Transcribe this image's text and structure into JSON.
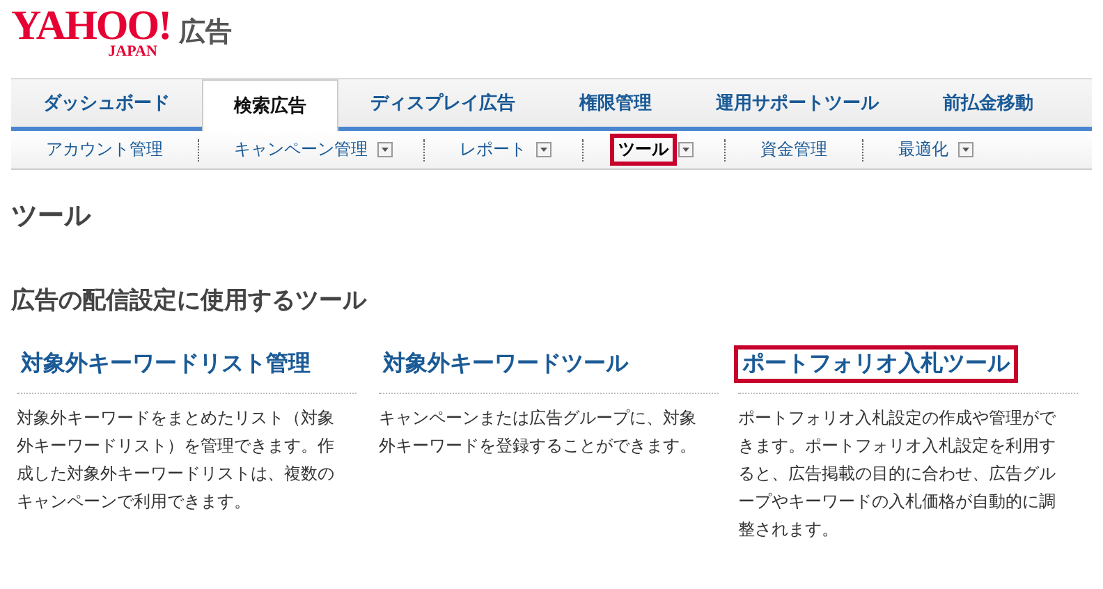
{
  "header": {
    "logo": {
      "name": "YAHOO!",
      "sub": "JAPAN"
    },
    "service": "広告"
  },
  "tabs": [
    {
      "label": "ダッシュボード",
      "selected": false
    },
    {
      "label": "検索広告",
      "selected": true
    },
    {
      "label": "ディスプレイ広告",
      "selected": false
    },
    {
      "label": "権限管理",
      "selected": false
    },
    {
      "label": "運用サポートツール",
      "selected": false
    },
    {
      "label": "前払金移動",
      "selected": false
    }
  ],
  "subnav": [
    {
      "label": "アカウント管理",
      "dropdown": false,
      "selected": false
    },
    {
      "label": "キャンペーン管理",
      "dropdown": true,
      "selected": false
    },
    {
      "label": "レポート",
      "dropdown": true,
      "selected": false
    },
    {
      "label": "ツール",
      "dropdown": true,
      "selected": true
    },
    {
      "label": "資金管理",
      "dropdown": false,
      "selected": false
    },
    {
      "label": "最適化",
      "dropdown": true,
      "selected": false
    }
  ],
  "page_title": "ツール",
  "section_title": "広告の配信設定に使用するツール",
  "tools": [
    {
      "title": "対象外キーワードリスト管理",
      "description": "対象外キーワードをまとめたリスト（対象外キーワードリスト）を管理できます。作成した対象外キーワードリストは、複数のキャンペーンで利用できます。",
      "highlighted": false
    },
    {
      "title": "対象外キーワードツール",
      "description": "キャンペーンまたは広告グループに、対象外キーワードを登録することができます。",
      "highlighted": false
    },
    {
      "title": "ポートフォリオ入札ツール",
      "description": "ポートフォリオ入札設定の作成や管理ができます。ポートフォリオ入札設定を利用すると、広告掲載の目的に合わせ、広告グループやキーワードの入札価格が自動的に調整されます。",
      "highlighted": true
    }
  ]
}
